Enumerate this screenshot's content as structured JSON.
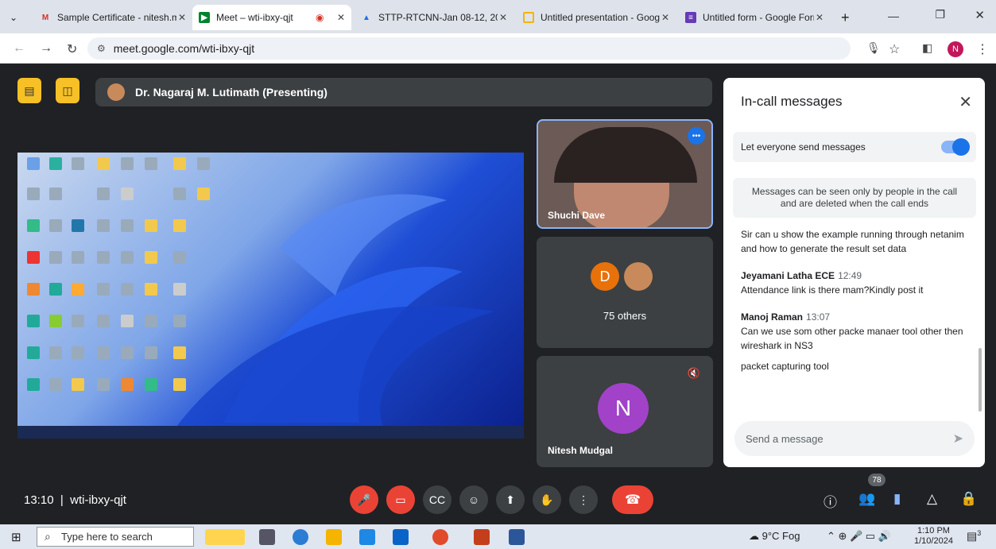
{
  "browser": {
    "tabs": [
      {
        "label": "Sample Certificate - nitesh.m",
        "icon": "gmail-icon"
      },
      {
        "label": "Meet – wti-ibxy-qjt",
        "icon": "meet-icon"
      },
      {
        "label": "STTP-RTCNN-Jan 08-12, 202",
        "icon": "drive-icon"
      },
      {
        "label": "Untitled presentation - Goog",
        "icon": "slides-icon"
      },
      {
        "label": "Untitled form - Google Form",
        "icon": "forms-icon"
      }
    ],
    "new_tab": "+",
    "url": "meet.google.com/wti-ibxy-qjt",
    "profile_initial": "N"
  },
  "meet": {
    "presenter_bar": "Dr. Nagaraj M. Lutimath (Presenting)",
    "tiles": [
      {
        "name": "Shuchi Dave"
      },
      {
        "name": "75 others",
        "initial": "D"
      },
      {
        "name": "Nitesh Mudgal",
        "initial": "N"
      }
    ],
    "time": "13:10",
    "meeting_code": "wti-ibxy-qjt",
    "participants_count": "78",
    "colors": {
      "accent": "#1a73e8",
      "danger": "#ea4335",
      "tile_d": "#e8710a",
      "tile_n": "#a142c8"
    }
  },
  "panel": {
    "title": "In-call messages",
    "toggle_label": "Let everyone send messages",
    "notice": "Messages can be seen only by people in the call and are deleted when the call ends",
    "messages": [
      {
        "sender": "",
        "time": "",
        "lines": [
          "Sir can u show the example running through netanim and how to generate the result set data"
        ]
      },
      {
        "sender": "Jeyamani Latha ECE",
        "time": "12:49",
        "lines": [
          "Attendance link is there mam?Kindly post it"
        ]
      },
      {
        "sender": "Manoj Raman",
        "time": "13:07",
        "lines": [
          "Can we use som other packe manaer tool other then wireshark in NS3",
          "packet capturing tool"
        ]
      }
    ],
    "input_placeholder": "Send a message"
  },
  "taskbar": {
    "search_placeholder": "Type here to search",
    "weather": "9°C Fog",
    "clock_time": "1:10 PM",
    "clock_date": "1/10/2024",
    "notif_count": "3"
  }
}
